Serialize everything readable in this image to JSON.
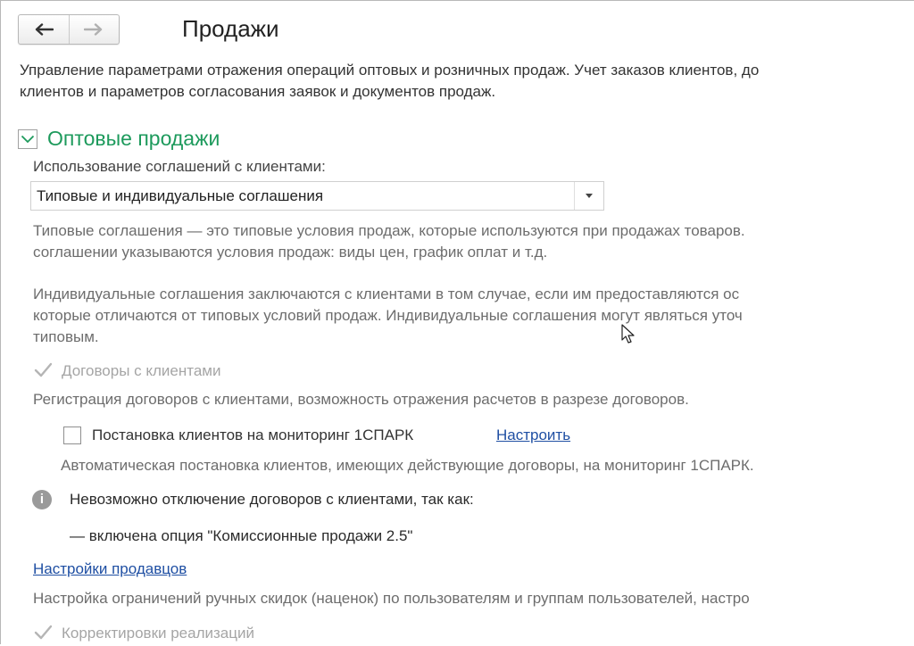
{
  "header": {
    "title": "Продажи",
    "back_icon": "arrow-left-icon",
    "forward_icon": "arrow-right-icon"
  },
  "description": {
    "line1": "Управление параметрами отражения операций оптовых и розничных продаж. Учет заказов клиентов, до",
    "line2": "клиентов и параметров согласования заявок и документов продаж."
  },
  "wholesale": {
    "title": "Оптовые продажи",
    "agreements_label": "Использование соглашений с клиентами:",
    "agreements_value": "Типовые и индивидуальные соглашения",
    "typical_hint_line1": "Типовые соглашения — это типовые условия продаж, которые используются при продажах товаров.",
    "typical_hint_line2": "соглашении указываются условия продаж: виды цен, график оплат и т.д.",
    "individual_hint_line1": "Индивидуальные соглашения заключаются с клиентами в том случае, если им предоставляются ос",
    "individual_hint_line2": "которые отличаются от типовых условий продаж. Индивидуальные соглашения могут являться уточ",
    "individual_hint_line3": "типовым.",
    "contracts": {
      "label": "Договоры с клиентами",
      "checked": true,
      "disabled": true,
      "hint": "Регистрация договоров с клиентами, возможность отражения расчетов в разрезе договоров."
    },
    "monitoring": {
      "label": "Постановка клиентов на мониторинг 1СПАРК",
      "checked": false,
      "link": "Настроить",
      "hint": "Автоматическая постановка клиентов, имеющих действующие договоры, на мониторинг 1СПАРК."
    },
    "info": {
      "icon": "info-icon",
      "message": "Невозможно отключение договоров с клиентами, так как:",
      "reason": "— включена опция \"Комиссионные продажи 2.5\""
    },
    "seller_settings_link": "Настройки продавцов",
    "seller_settings_hint": "Настройка ограничений ручных скидок (наценок) по пользователям и группам пользователей, настро",
    "corrections": {
      "label": "Корректировки реализаций",
      "checked": true,
      "disabled": true
    }
  },
  "colors": {
    "section_title": "#1d9a5c",
    "link": "#1f4fa3",
    "disabled_text": "#a5a5a5"
  }
}
